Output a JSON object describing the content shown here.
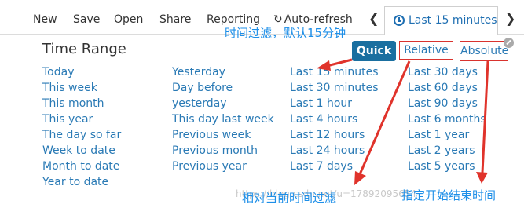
{
  "toolbar": {
    "new": "New",
    "save": "Save",
    "open": "Open",
    "share": "Share",
    "reporting": "Reporting",
    "auto_refresh": "Auto-refresh",
    "refresh_icon": "refresh-icon",
    "prev_icon": "chevron-left-icon",
    "next_icon": "chevron-right-icon",
    "timepicker_label": "Last 15 minutes",
    "timepicker_icon": "clock-icon"
  },
  "panel": {
    "title": "Time Range",
    "modes": {
      "quick": "Quick",
      "relative": "Relative",
      "absolute": "Absolute"
    },
    "active_mode": "Quick",
    "accent_color": "#1a6fa0",
    "link_color": "#2a7ab5",
    "columns": [
      [
        "Today",
        "This week",
        "This month",
        "This year",
        "The day so far",
        "Week to date",
        "Month to date",
        "Year to date"
      ],
      [
        "Yesterday",
        "Day before",
        "yesterday",
        "This day last week",
        "Previous week",
        "Previous month",
        "Previous year"
      ],
      [
        "Last 15 minutes",
        "Last 30 minutes",
        "Last 1 hour",
        "Last 4 hours",
        "Last 12 hours",
        "Last 24 hours",
        "Last 7 days"
      ],
      [
        "Last 30 days",
        "Last 60 days",
        "Last 90 days",
        "Last 6 months",
        "Last 1 year",
        "Last 2 years",
        "Last 5 years"
      ]
    ]
  },
  "annotations": {
    "quick_note": "时间过滤，默认15分钟",
    "relative_note": "相对当前时间过滤",
    "absolute_note": "指定开始结束时间",
    "highlight_color": "#d9332e",
    "note_color": "#1e8fe8",
    "watermark": "https://blog.csdn.net/u=17892095654"
  }
}
